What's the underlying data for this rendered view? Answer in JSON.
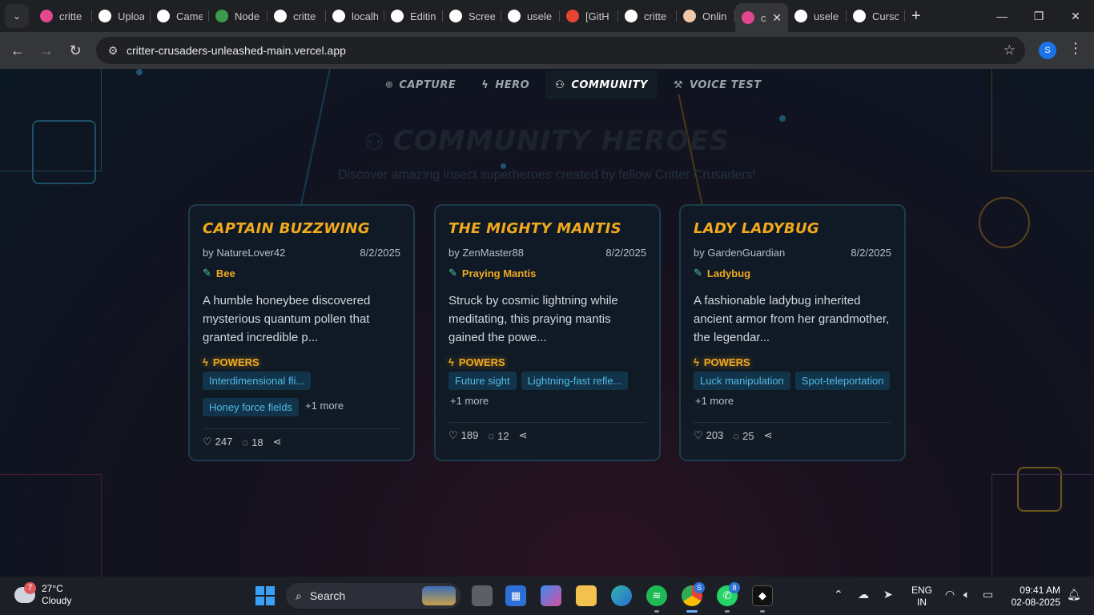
{
  "browser": {
    "tabs": [
      {
        "label": "critte",
        "icon": "claude-icon",
        "color": "#e2478f"
      },
      {
        "label": "Uploa",
        "icon": "github-icon",
        "color": "#ffffff"
      },
      {
        "label": "Came",
        "icon": "chatgpt-icon",
        "color": "#ffffff"
      },
      {
        "label": "Node",
        "icon": "nodejs-icon",
        "color": "#3c9b4a"
      },
      {
        "label": "critte",
        "icon": "github-icon",
        "color": "#ffffff"
      },
      {
        "label": "localh",
        "icon": "globe-icon",
        "color": "#ffffff"
      },
      {
        "label": "Editin",
        "icon": "github-icon",
        "color": "#ffffff"
      },
      {
        "label": "Scree",
        "icon": "globe-icon",
        "color": "#ffffff"
      },
      {
        "label": "usele",
        "icon": "github-icon",
        "color": "#ffffff"
      },
      {
        "label": "[GitH",
        "icon": "gmail-icon",
        "color": "#ea4335"
      },
      {
        "label": "critte",
        "icon": "vercel-icon",
        "color": "#ffffff"
      },
      {
        "label": "Onlin",
        "icon": "profile-icon",
        "color": "#f0c7a8"
      },
      {
        "label": "c",
        "icon": "claude-icon",
        "color": "#e2478f",
        "active": true
      },
      {
        "label": "usele",
        "icon": "github-icon",
        "color": "#ffffff"
      },
      {
        "label": "Cursc",
        "icon": "cursor-icon",
        "color": "#ffffff"
      }
    ],
    "url": "critter-crusaders-unleashed-main.vercel.app",
    "profile_initial": "S"
  },
  "nav": [
    {
      "label": "CAPTURE",
      "icon": "camera-icon",
      "glyph": "📷"
    },
    {
      "label": "HERO",
      "icon": "lightning-icon",
      "glyph": "⚡"
    },
    {
      "label": "COMMUNITY",
      "icon": "users-icon",
      "glyph": "👥",
      "active": true
    },
    {
      "label": "VOICE TEST",
      "icon": "hammer-icon",
      "glyph": "🔨"
    }
  ],
  "page": {
    "title": "COMMUNITY HEROES",
    "subtitle": "Discover amazing insect superheroes created by fellow Critter Crusaders!"
  },
  "cards": [
    {
      "title": "CAPTAIN BUZZWING",
      "author": "by NatureLover42",
      "date": "8/2/2025",
      "species": "Bee",
      "description": "A humble honeybee discovered mysterious quantum pollen that granted incredible p...",
      "powers_label": "POWERS",
      "powers": [
        "Interdimensional fli...",
        "Honey force fields"
      ],
      "more": "+1 more",
      "likes": "247",
      "comments": "18"
    },
    {
      "title": "THE MIGHTY MANTIS",
      "author": "by ZenMaster88",
      "date": "8/2/2025",
      "species": "Praying Mantis",
      "description": "Struck by cosmic lightning while meditating, this praying mantis gained the powe...",
      "powers_label": "POWERS",
      "powers": [
        "Future sight",
        "Lightning-fast refle..."
      ],
      "more": "+1 more",
      "likes": "189",
      "comments": "12"
    },
    {
      "title": "LADY LADYBUG",
      "author": "by GardenGuardian",
      "date": "8/2/2025",
      "species": "Ladybug",
      "description": "A fashionable ladybug inherited ancient armor from her grandmother, the legendar...",
      "powers_label": "POWERS",
      "powers": [
        "Luck manipulation",
        "Spot-teleportation"
      ],
      "more": "+1 more",
      "likes": "203",
      "comments": "25"
    }
  ],
  "taskbar": {
    "weather_badge": "7",
    "temperature": "27°C",
    "condition": "Cloudy",
    "search_label": "Search",
    "whatsapp_badge": "8",
    "chrome_badge": "S",
    "lang_top": "ENG",
    "lang_bottom": "IN",
    "time": "09:41 AM",
    "date": "02-08-2025"
  },
  "colors": {
    "accent": "#f1a91e",
    "tag_text": "#52b9e6",
    "species_icon": "#4ec9a2"
  }
}
